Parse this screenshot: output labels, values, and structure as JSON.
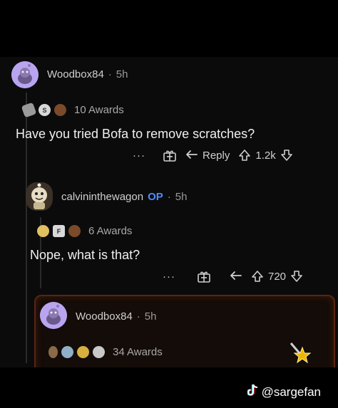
{
  "comments": [
    {
      "username": "Woodbox84",
      "time": "5h",
      "awards_label": "10 Awards",
      "text": "Have you tried Bofa to remove scratches?",
      "more": "···",
      "reply_label": "Reply",
      "score": "1.2k"
    },
    {
      "username": "calvininthewagon",
      "op_badge": "OP",
      "time": "5h",
      "awards_label": "6 Awards",
      "text": "Nope, what is that?",
      "more": "···",
      "score": "720"
    },
    {
      "username": "Woodbox84",
      "time": "5h",
      "awards_label": "34 Awards"
    }
  ],
  "separator": "·",
  "watermark": {
    "handle": "@sargefan",
    "logo_icon": "tiktok-icon"
  },
  "colors": {
    "background": "#0b0b0b",
    "avatar": "#b9a4f0",
    "op": "#4f8cff",
    "highlight_border": "#5a2412"
  }
}
